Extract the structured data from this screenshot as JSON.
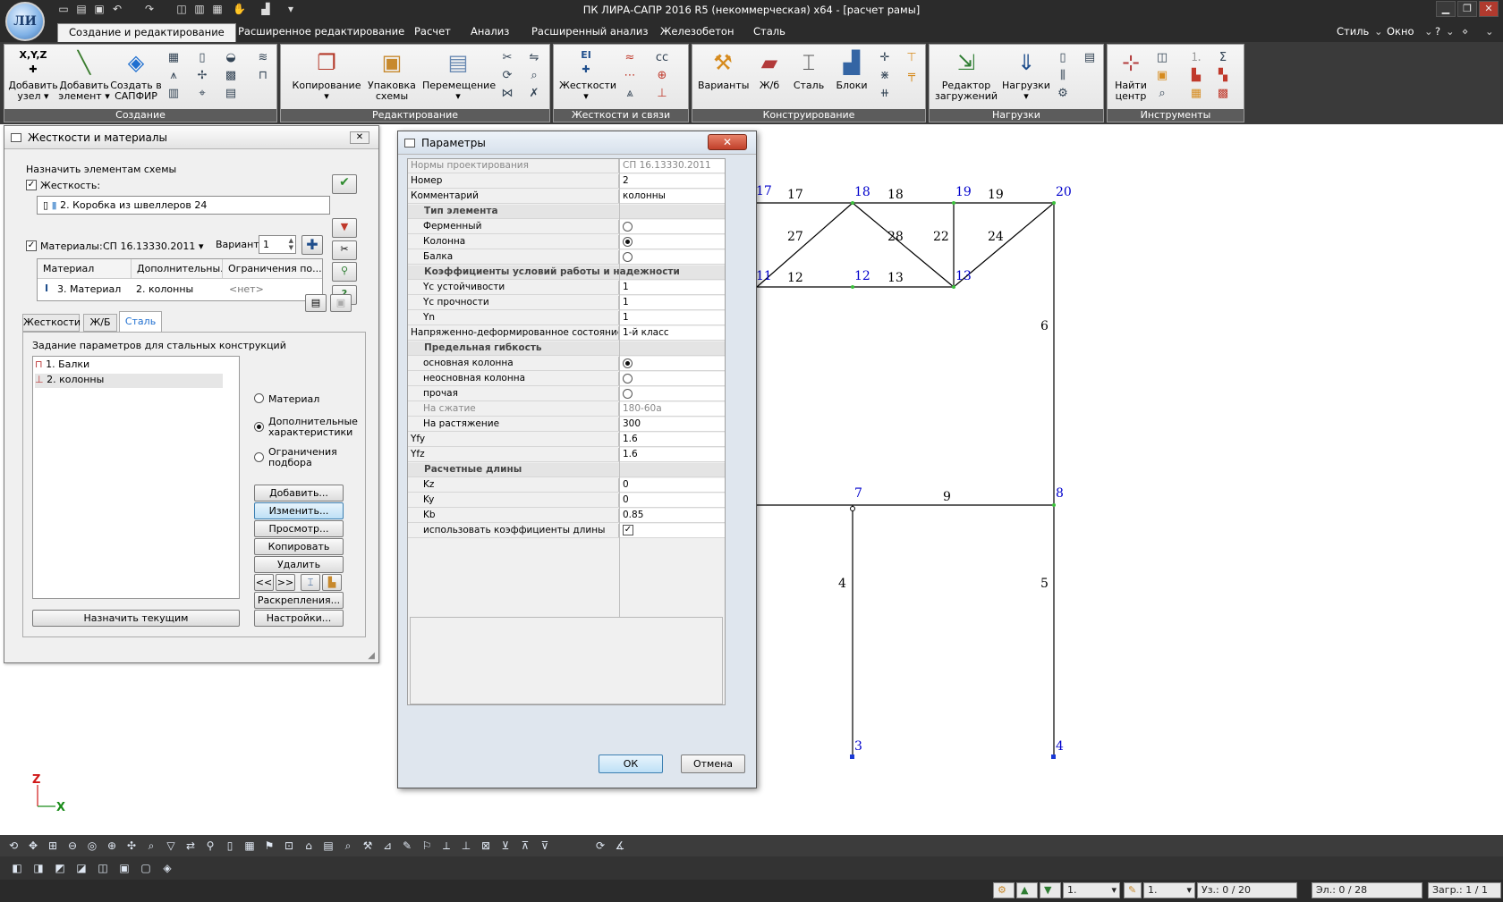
{
  "window": {
    "title": "ПК ЛИРА-САПР  2016 R5 (некоммерческая) x64 - [расчет рамы]",
    "logo_text": "ЛИ",
    "controls": [
      "▁",
      "❐",
      "✕"
    ]
  },
  "menu": {
    "tabs": [
      "Создание и редактирование",
      "Расширенное редактирование",
      "Расчет",
      "Анализ",
      "Расширенный анализ",
      "Железобетон",
      "Сталь"
    ],
    "style_label": "Стиль",
    "window_label": "Окно",
    "help_label": "?"
  },
  "ribbon": {
    "groups": [
      {
        "label": "Создание",
        "buttons": [
          "Добавить узел",
          "Добавить элемент",
          "Создать в САПФИР"
        ]
      },
      {
        "label": "Редактирование",
        "buttons": [
          "Копирование",
          "Упаковка схемы",
          "Перемещение"
        ]
      },
      {
        "label": "Жесткости и связи",
        "buttons": [
          "Жесткости"
        ]
      },
      {
        "label": "Конструирование",
        "buttons": [
          "Варианты",
          "Ж/б",
          "Сталь",
          "Блоки"
        ]
      },
      {
        "label": "Нагрузки",
        "buttons": [
          "Редактор загружений",
          "Нагрузки"
        ]
      },
      {
        "label": "Инструменты",
        "buttons": [
          "Найти центр"
        ]
      }
    ],
    "button_lines": {
      "add_node": [
        "Добавить",
        "узел"
      ],
      "add_element": [
        "Добавить",
        "элемент"
      ],
      "sapfir": [
        "Создать в",
        "САПФИР"
      ],
      "copy": [
        "Копирование",
        ""
      ],
      "pack": [
        "Упаковка",
        "схемы"
      ],
      "move": [
        "Перемещение",
        ""
      ],
      "stiffness": [
        "Жесткости",
        ""
      ],
      "variants": [
        "Варианты"
      ],
      "rc": [
        "Ж/б"
      ],
      "steel": [
        "Сталь"
      ],
      "blocks": [
        "Блоки"
      ],
      "load_editor": [
        "Редактор",
        "загружений"
      ],
      "loads": [
        "Нагрузки",
        ""
      ],
      "find_center": [
        "Найти",
        "центр"
      ]
    }
  },
  "stiffness_panel": {
    "title": "Жесткости и материалы",
    "assign_label": "Назначить элементам схемы",
    "stiffness_label": "Жесткость:",
    "stiffness_value": "2. Коробка из швеллеров 24",
    "materials_label": "Материалы:",
    "materials_norm": "СП 16.13330.2011",
    "variant_label": "Вариант",
    "variant_value": "1",
    "table_headers": [
      "Материал",
      "Дополнительны...",
      "Ограничения по..."
    ],
    "table_row": [
      "3. Материал",
      "2. колонны",
      "<нет>"
    ],
    "tabs": [
      "Жесткости",
      "Ж/Б",
      "Сталь"
    ],
    "steel_params_label": "Задание параметров для стальных конструкций",
    "list_items": [
      "1. Балки",
      "2. колонны"
    ],
    "radio_options": [
      "Материал",
      "Дополнительные характеристики",
      "Ограничения подбора"
    ],
    "buttons": [
      "Добавить...",
      "Изменить...",
      "Просмотр...",
      "Копировать",
      "Удалить",
      "Раскрепления...",
      "Настройки..."
    ],
    "nav_buttons": [
      "<<",
      ">>"
    ],
    "assign_current": "Назначить текущим"
  },
  "params_dialog": {
    "title": "Параметры",
    "rows": [
      {
        "k": "Нормы проектирования",
        "v": "СП 16.13330.2011",
        "type": "gray"
      },
      {
        "k": "Номер",
        "v": "2",
        "type": "text"
      },
      {
        "k": "Комментарий",
        "v": "колонны",
        "type": "text"
      },
      {
        "k": "Тип элемента",
        "type": "section"
      },
      {
        "k": "Ферменный",
        "type": "radio",
        "on": false
      },
      {
        "k": "Колонна",
        "type": "radio",
        "on": true
      },
      {
        "k": "Балка",
        "type": "radio",
        "on": false
      },
      {
        "k": "Коэффициенты условий работы и надежности",
        "type": "section"
      },
      {
        "k": "Yc устойчивости",
        "v": "1",
        "type": "text",
        "indent": true
      },
      {
        "k": "Yc прочности",
        "v": "1",
        "type": "text",
        "indent": true
      },
      {
        "k": "Yn",
        "v": "1",
        "type": "text",
        "indent": true
      },
      {
        "k": "Напряженно-деформированное состояние",
        "v": "1-й класс",
        "type": "text"
      },
      {
        "k": "Предельная гибкость",
        "type": "section"
      },
      {
        "k": "основная колонна",
        "type": "radio",
        "on": true
      },
      {
        "k": "неосновная колонна",
        "type": "radio",
        "on": false
      },
      {
        "k": "прочая",
        "type": "radio",
        "on": false
      },
      {
        "k": "На сжатие",
        "v": "180-60a",
        "type": "gray",
        "indent": true
      },
      {
        "k": "На растяжение",
        "v": "300",
        "type": "text",
        "indent": true
      },
      {
        "k": "Yfy",
        "v": "1.6",
        "type": "text"
      },
      {
        "k": "Yfz",
        "v": "1.6",
        "type": "text"
      },
      {
        "k": "Расчетные длины",
        "type": "section"
      },
      {
        "k": "Kz",
        "v": "0",
        "type": "text",
        "indent": true
      },
      {
        "k": "Ky",
        "v": "0",
        "type": "text",
        "indent": true
      },
      {
        "k": "Kb",
        "v": "0.85",
        "type": "text",
        "indent": true
      },
      {
        "k": "использовать коэффициенты длины",
        "type": "check",
        "on": true,
        "indent": true
      }
    ],
    "ok": "ОК",
    "cancel": "Отмена"
  },
  "scheme": {
    "nodes": [
      {
        "label": "17"
      },
      {
        "label": "18"
      },
      {
        "label": "19"
      },
      {
        "label": "20"
      },
      {
        "label": "11"
      },
      {
        "label": "12"
      },
      {
        "label": "13"
      },
      {
        "label": "7"
      },
      {
        "label": "8"
      },
      {
        "label": "3"
      },
      {
        "label": "4"
      }
    ],
    "elements": [
      "17",
      "18",
      "19",
      "27",
      "28",
      "22",
      "24",
      "12",
      "13",
      "6",
      "9",
      "4",
      "5"
    ]
  },
  "axis": {
    "z": "Z",
    "x": "X"
  },
  "status": {
    "load_case_1": "1.",
    "load_case_2": "1.",
    "nodes": "Уз.: 0 / 20",
    "elements": "Эл.: 0 / 28",
    "loads": "Загр.: 1 / 1"
  },
  "colors": {
    "accent": "#2b2b2b",
    "node_label": "#0000cc",
    "ribbon_label": "#5c5c5c"
  }
}
